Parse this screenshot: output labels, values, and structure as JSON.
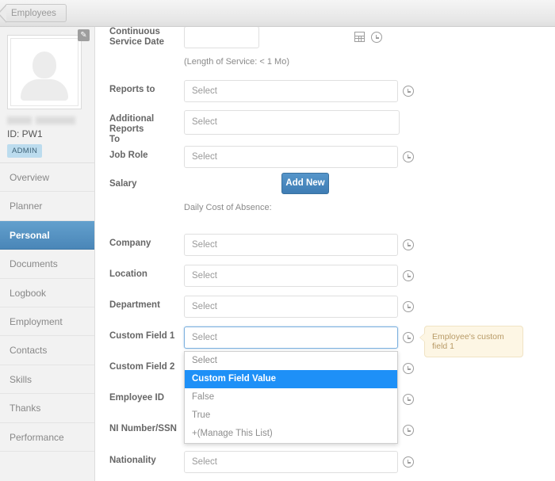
{
  "topbar": {
    "breadcrumb_label": "Employees"
  },
  "sidebar": {
    "employee": {
      "name_redacted": "",
      "id_label": "ID:  PW1",
      "role_badge": "ADMIN",
      "edit_icon": "pencil-icon"
    },
    "items": [
      {
        "label": "Overview",
        "active": false
      },
      {
        "label": "Planner",
        "active": false
      },
      {
        "label": "Personal",
        "active": true
      },
      {
        "label": "Documents",
        "active": false
      },
      {
        "label": "Logbook",
        "active": false
      },
      {
        "label": "Employment",
        "active": false
      },
      {
        "label": "Contacts",
        "active": false
      },
      {
        "label": "Skills",
        "active": false
      },
      {
        "label": "Thanks",
        "active": false
      },
      {
        "label": "Performance",
        "active": false
      }
    ]
  },
  "form": {
    "continuous_service_date": {
      "label_line1": "Continuous",
      "label_line2": "Service Date",
      "value": "",
      "calendar_icon": "calendar-icon",
      "clock_icon": "history-clock-icon"
    },
    "length_of_service_note": "(Length of Service: < 1 Mo)",
    "reports_to": {
      "label": "Reports to",
      "value": "Select"
    },
    "additional_reports": {
      "label_line1": "Additional Reports",
      "label_line2": "To",
      "value": "Select"
    },
    "job_role": {
      "label": "Job Role",
      "value": "Select"
    },
    "salary": {
      "label": "Salary",
      "button_label": "Add New"
    },
    "daily_cost_note": "Daily Cost of Absence:",
    "company": {
      "label": "Company",
      "value": "Select"
    },
    "location": {
      "label": "Location",
      "value": "Select"
    },
    "department": {
      "label": "Department",
      "value": "Select"
    },
    "custom_field_1": {
      "label": "Custom Field 1",
      "value": "Select"
    },
    "custom_field_2": {
      "label": "Custom Field 2"
    },
    "employee_id": {
      "label": "Employee ID"
    },
    "ni_number": {
      "label": "NI Number/SSN"
    },
    "nationality": {
      "label": "Nationality",
      "value": "Select"
    }
  },
  "dropdown": {
    "options": [
      {
        "label": "Select",
        "selected": false
      },
      {
        "label": "Custom Field Value",
        "selected": true
      },
      {
        "label": "False",
        "selected": false
      },
      {
        "label": "True",
        "selected": false
      },
      {
        "label": "+(Manage This List)",
        "selected": false
      }
    ]
  },
  "tooltip": {
    "text": "Employee's custom field 1"
  },
  "colors": {
    "accent_blue": "#4a86b8",
    "highlight_blue": "#1e90f7",
    "tooltip_bg": "#fdf6e4",
    "sidebar_bg": "#f2f2f2"
  }
}
